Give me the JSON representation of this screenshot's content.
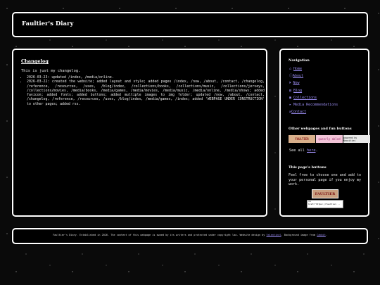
{
  "site_title": "Faultier's Diary",
  "main": {
    "heading": "Changelog",
    "intro": "This is just my changelog.",
    "entries": [
      "2026-03-23: updated /index, /media/online.",
      "2026-03-22: created the website; added layout and style; added pages /index, /now, /about, /contact, /changelog, /reference, /resources, /uses, /blog/index, /collections/books, /collections/music, /collections/jerseys, /collections/movies, /media/books, /media/games, /media/movies, /media/music, /media/online, /media/shows; added favicon; added fonts; added buttons; added multiple images to img folder; updated /now, /about, /contact, /changelog, /reference, /resources, /uses, /blog/index, /media/games, /index; added 'WEBPAGE UNDER CONSTRUCTION' to other pages; added rss."
    ]
  },
  "sidebar": {
    "nav_heading": "Navigation",
    "nav": [
      {
        "icon": "⌂",
        "label": "Home",
        "link": true
      },
      {
        "icon": "ⓘ",
        "label": "About",
        "link": true
      },
      {
        "icon": "⏵",
        "label": "Now",
        "link": true
      },
      {
        "icon": "▤",
        "label": "Blog",
        "link": true
      },
      {
        "icon": "▣",
        "label": "Collections",
        "link": true
      },
      {
        "icon": "▸",
        "label": "Media Recommendations",
        "link": false
      },
      {
        "icon": "✉",
        "label": "Contact",
        "link": true
      }
    ],
    "other_heading": "Other webpages and fun buttons",
    "buttons": [
      {
        "text": "FAULTIER",
        "bg": "#d9b08c",
        "fg": "#8b1a1a"
      },
      {
        "text": "queerly abled",
        "bg": "#f2c4d8",
        "fg": "#a03070"
      },
      {
        "text": "powered by Neocities",
        "bg": "#e8e8e8",
        "fg": "#222"
      }
    ],
    "see_all_prefix": "See all ",
    "see_all_link": "here",
    "see_all_suffix": ".",
    "this_heading": "This page's buttons",
    "feel_free": "Feel free to choose one and add to your personal page if you enjoy my work.",
    "my_button": "FAULTIER",
    "code_snippet": "<a href=\"https://faultier..."
  },
  "footer": {
    "text": "Faultier's Diary. Established in 2026. The content of this webpage is owned by its writers and protected under copyright law. Website design by ",
    "designer": "Valentinel",
    "mid": ". Background image from ",
    "bg_source": "Cabbit",
    "end": "."
  }
}
